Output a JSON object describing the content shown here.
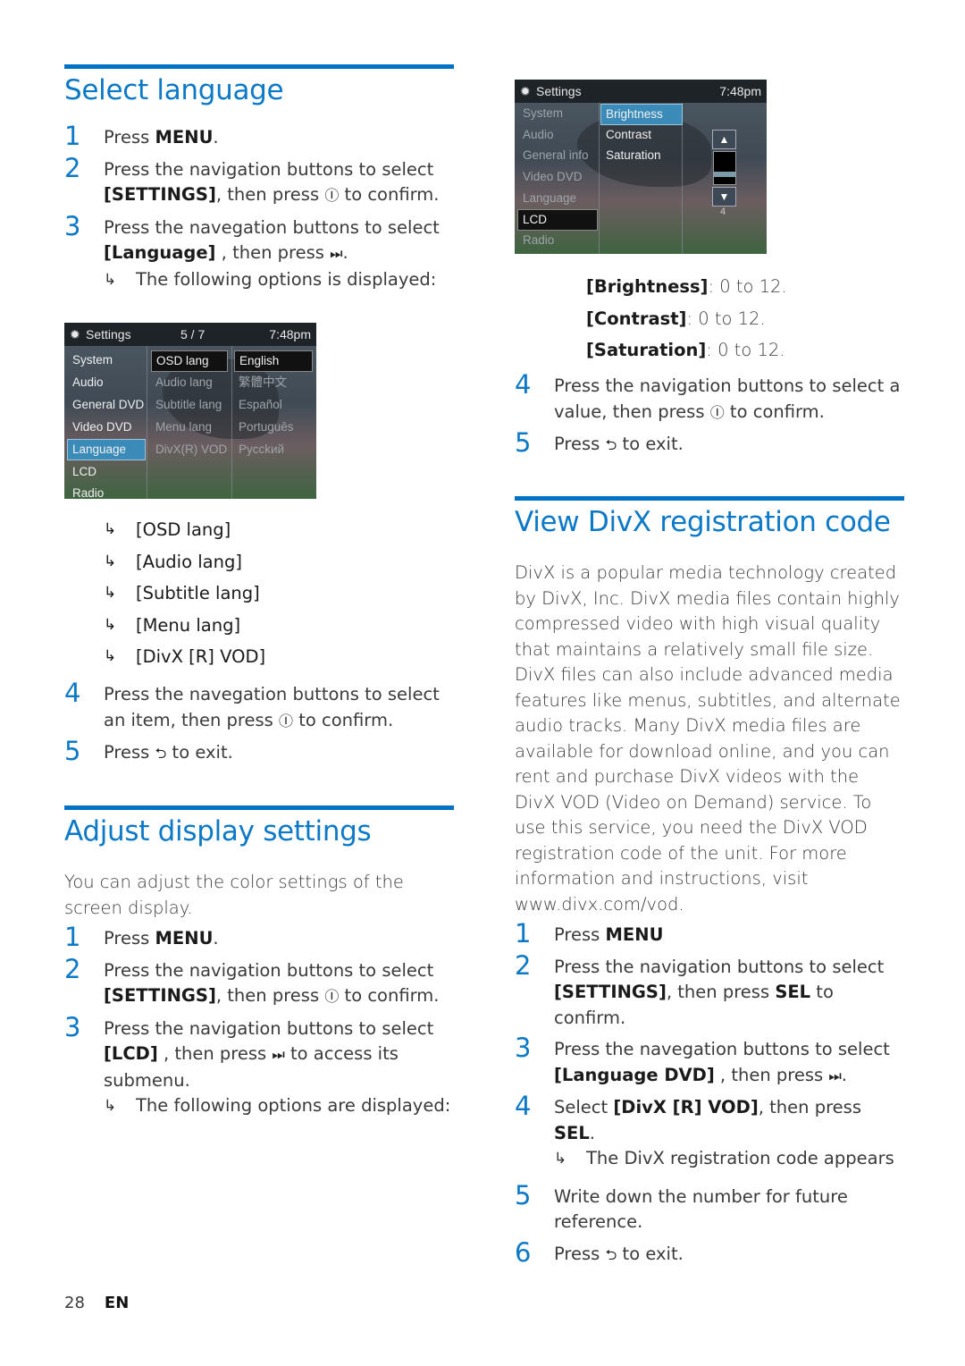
{
  "sections": {
    "select_language": {
      "title": "Select language",
      "steps": [
        {
          "num": "1",
          "pre": "Press ",
          "bold": "MENU",
          "post": "."
        },
        {
          "num": "2",
          "line1": "Press the navigation buttons to select",
          "bold": "[SETTINGS]",
          "post": ", then press",
          "icon": "Ⓘ",
          "post2": " to confirm."
        },
        {
          "num": "3",
          "line1": "Press the navegation buttons to select",
          "bold": "[Language]",
          "post": " , then press ",
          "icon": "⏭",
          "post2": "."
        },
        {
          "num": "4",
          "text": "Press the navegation buttons to select an item, then press",
          "icon": "Ⓘ",
          "post": " to confirm."
        },
        {
          "num": "5",
          "pre": "Press ",
          "icon": "⮌",
          "post": " to exit."
        }
      ],
      "result_note": "The following options is displayed:",
      "options": [
        "[OSD lang]",
        "[Audio lang]",
        "[Subtitle lang]",
        "[Menu lang]",
        "[DivX [R] VOD]"
      ],
      "screen": {
        "title": "Settings",
        "page": "5 / 7",
        "time": "7:48pm",
        "menu": [
          "System",
          "Audio",
          "General DVD",
          "Video DVD",
          "Language",
          "LCD",
          "Radio"
        ],
        "selected_menu": "Language",
        "submenu": [
          "OSD lang",
          "Audio lang",
          "Subtitle lang",
          "Menu lang",
          "DivX(R) VOD"
        ],
        "values": [
          "English",
          "繁體中文",
          "Español",
          "Português",
          "Pycckий"
        ]
      }
    },
    "adjust_display": {
      "title": "Adjust display settings",
      "intro": "You can adjust the color settings of the screen display.",
      "steps": [
        {
          "num": "1",
          "pre": "Press ",
          "bold": "MENU",
          "post": "."
        },
        {
          "num": "2",
          "line1": "Press the navigation buttons to select",
          "bold": "[SETTINGS]",
          "post": ", then press",
          "icon": "Ⓘ",
          "post2": " to confirm."
        },
        {
          "num": "3",
          "line1": "Press the navigation buttons to select",
          "bold": "[LCD]",
          "post": " , then press ",
          "icon": "⏭",
          "post2": " to access its submenu."
        },
        {
          "num": "4",
          "text": "Press the navigation buttons to select a value, then press",
          "icon": "Ⓘ",
          "post": " to confirm."
        },
        {
          "num": "5",
          "pre": "Press ",
          "icon": "⮌",
          "post": " to exit."
        }
      ],
      "result_note": "The following options are displayed:",
      "ranges": [
        {
          "label": "[Brightness]",
          "range": ": 0 to 12."
        },
        {
          "label": "[Contrast]",
          "range": ": 0 to 12."
        },
        {
          "label": "[Saturation]",
          "range": ": 0 to 12."
        }
      ],
      "screen": {
        "title": "Settings",
        "time": "7:48pm",
        "menu": [
          "System",
          "Audio",
          "General info",
          "Video DVD",
          "Language",
          "LCD",
          "Radio"
        ],
        "selected_menu": "LCD",
        "submenu": [
          "Brightness",
          "Contrast",
          "Saturation"
        ],
        "slider_value": "4"
      }
    },
    "divx": {
      "title": "View DivX registration code",
      "intro": "DivX is a popular media technology created by DivX, Inc. DivX media files contain highly compressed video with high visual quality that maintains a relatively small file size. DivX files can also include advanced media features like menus, subtitles, and alternate audio tracks. Many DivX media files are available for download online, and you can rent and purchase DivX videos with the DivX VOD (Video on Demand) service. To use this service, you need the DivX VOD registration code of the unit. For more information and instructions, visit www.divx.com/vod.",
      "steps": [
        {
          "num": "1",
          "pre": "Press ",
          "bold": "MENU",
          "post": ""
        },
        {
          "num": "2",
          "line1": "Press the navigation buttons to select",
          "bold": "[SETTINGS]",
          "post": ", then press ",
          "bold2": "SEL",
          "post2": " to confirm."
        },
        {
          "num": "3",
          "line1": "Press the navegation buttons to select",
          "bold": "[Language DVD]",
          "post": " , then press ",
          "icon": "⏭",
          "post2": "."
        },
        {
          "num": "4",
          "pre": "Select ",
          "bold": "[DivX [R] VOD]",
          "post": ", then press ",
          "bold2": "SEL",
          "post2": "."
        },
        {
          "num": "5",
          "text": "Write down the number for future reference."
        },
        {
          "num": "6",
          "pre": "Press ",
          "icon": "⮌",
          "post": " to exit."
        }
      ],
      "result_note": "The DivX registration code appears"
    }
  },
  "footer": {
    "page_number": "28",
    "language": "EN"
  },
  "colors": {
    "accent": "#0b79c8",
    "rule": "#0073c6"
  }
}
